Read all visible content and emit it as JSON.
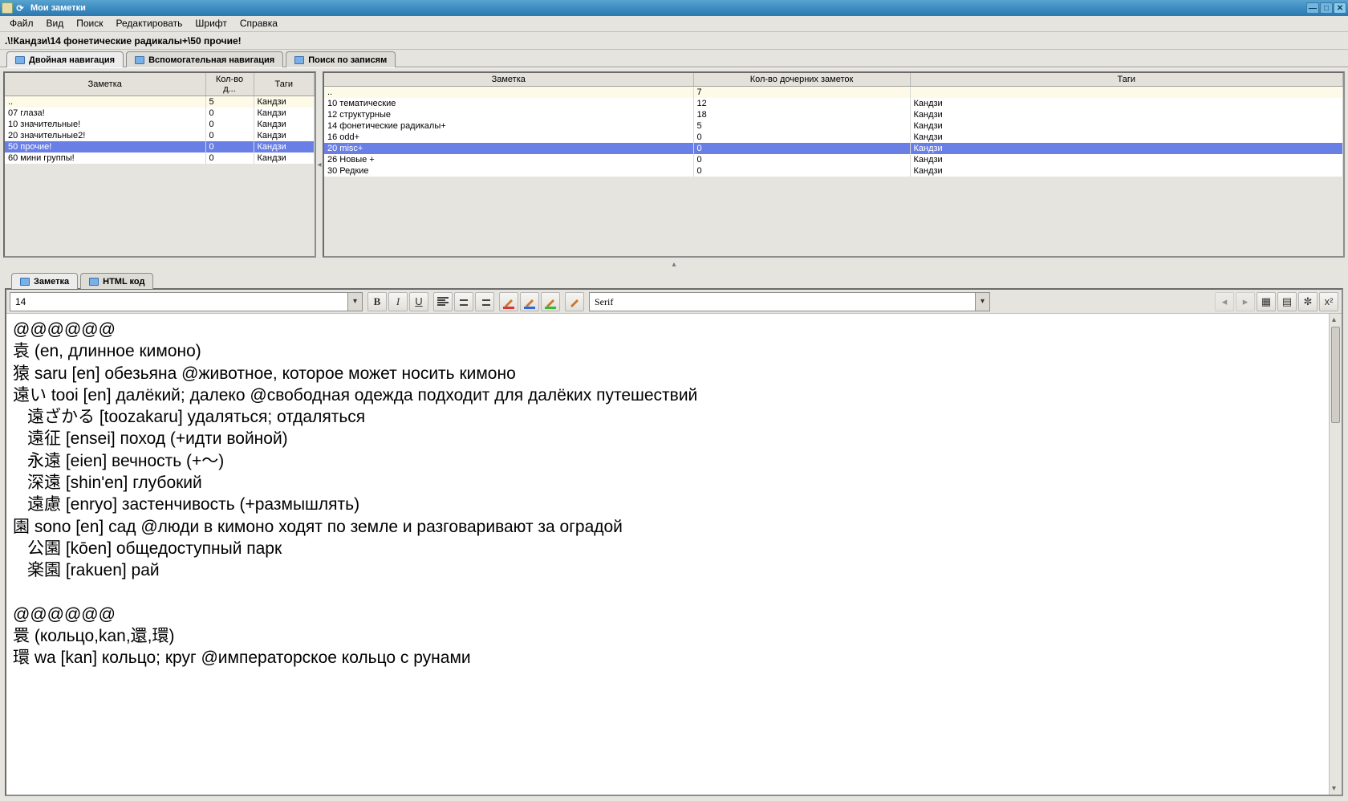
{
  "window": {
    "title": "Мои заметки"
  },
  "menu": {
    "items": [
      "Файл",
      "Вид",
      "Поиск",
      "Редактировать",
      "Шрифт",
      "Справка"
    ]
  },
  "breadcrumb": ".\\!Кандзи\\14 фонетические радикалы+\\50 прочие!",
  "nav_tabs": [
    {
      "label": "Двойная навигация",
      "active": true
    },
    {
      "label": "Вспомогательная навигация",
      "active": false
    },
    {
      "label": "Поиск по записям",
      "active": false
    }
  ],
  "left_pane": {
    "columns": [
      "Заметка",
      "Кол-во д...",
      "Таги"
    ],
    "rows": [
      {
        "cells": [
          "..",
          "5",
          "Кандзи"
        ],
        "parent": true
      },
      {
        "cells": [
          "07 глаза!",
          "0",
          "Кандзи"
        ]
      },
      {
        "cells": [
          "10 значительные!",
          "0",
          "Кандзи"
        ]
      },
      {
        "cells": [
          "20 значительные2!",
          "0",
          "Кандзи"
        ]
      },
      {
        "cells": [
          "50 прочие!",
          "0",
          "Кандзи"
        ],
        "selected": true
      },
      {
        "cells": [
          "60 мини группы!",
          "0",
          "Кандзи"
        ]
      }
    ]
  },
  "right_pane": {
    "columns": [
      "Заметка",
      "Кол-во дочерних заметок",
      "Таги"
    ],
    "rows": [
      {
        "cells": [
          "..",
          "7",
          ""
        ],
        "parent": true
      },
      {
        "cells": [
          "10 тематические",
          "12",
          "Кандзи"
        ]
      },
      {
        "cells": [
          "12 структурные",
          "18",
          "Кандзи"
        ]
      },
      {
        "cells": [
          "14 фонетические радикалы+",
          "5",
          "Кандзи"
        ]
      },
      {
        "cells": [
          "16 odd+",
          "0",
          "Кандзи"
        ]
      },
      {
        "cells": [
          "20 misc+",
          "0",
          "Кандзи"
        ],
        "selected": true
      },
      {
        "cells": [
          "26 Новые +",
          "0",
          "Кандзи"
        ]
      },
      {
        "cells": [
          "30 Редкие",
          "0",
          "Кандзи"
        ]
      }
    ]
  },
  "note_tabs": [
    {
      "label": "Заметка",
      "active": true
    },
    {
      "label": "HTML код",
      "active": false
    }
  ],
  "editor_toolbar": {
    "font_size": "14",
    "font_family": "Serif"
  },
  "note_lines": [
    "@@@@@@",
    "袁 (en, длинное кимоно)",
    "猿 saru [en] обезьяна @животное, которое может носить кимоно",
    "遠い tooi [en] далёкий; далеко @свободная одежда подходит для далёких путешествий",
    {
      "indent": true,
      "text": "遠ざかる [toozakaru] удаляться; отдаляться"
    },
    {
      "indent": true,
      "text": "遠征 [ensei] поход (+идти войной)"
    },
    {
      "indent": true,
      "text": "永遠 [eien] вечность (+～)"
    },
    {
      "indent": true,
      "text": "深遠 [shin'en] глубокий"
    },
    {
      "indent": true,
      "text": "遠慮 [enryo] застенчивость (+размышлять)"
    },
    "園 sono [en] сад @люди в кимоно ходят по земле и разговаривают за оградой",
    {
      "indent": true,
      "text": "公園 [kōen] общедоступный парк"
    },
    {
      "indent": true,
      "text": "楽園 [rakuen] рай"
    },
    "",
    "@@@@@@",
    "睘 (кольцо,kan,還,環)",
    "環 wa [kan] кольцо; круг @императорское кольцо с рунами"
  ]
}
